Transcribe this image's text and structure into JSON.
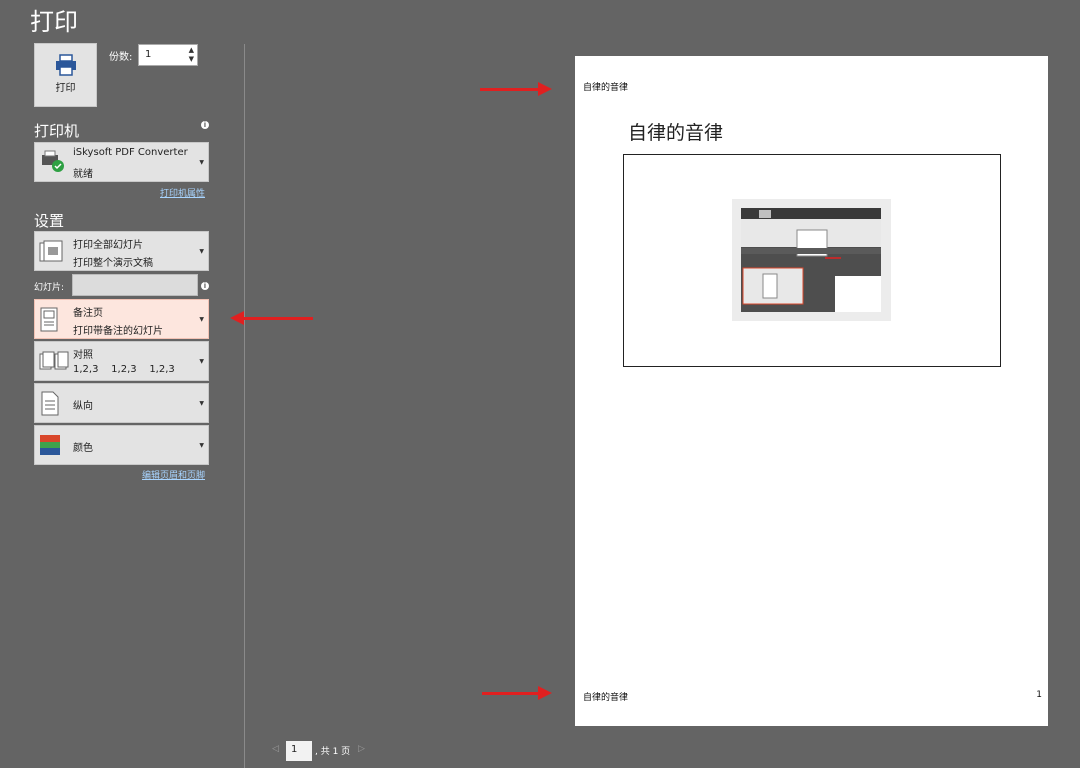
{
  "title": "打印",
  "print_button": {
    "label": "打印"
  },
  "copies": {
    "label": "份数:",
    "value": "1"
  },
  "printer": {
    "heading": "打印机",
    "name": "iSkysoft PDF Converter",
    "status": "就绪",
    "properties_link": "打印机属性"
  },
  "settings": {
    "heading": "设置",
    "range": {
      "line1": "打印全部幻灯片",
      "line2": "打印整个演示文稿"
    },
    "slides_label": "幻灯片:",
    "layout": {
      "line1": "备注页",
      "line2": "打印带备注的幻灯片"
    },
    "collate": {
      "line1": "对照",
      "line2": "1,2,3    1,2,3    1,2,3"
    },
    "orientation": {
      "line1": "纵向"
    },
    "color": {
      "line1": "颜色"
    },
    "header_footer_link": "编辑页眉和页脚"
  },
  "preview": {
    "header_text": "自律的音律",
    "slide_title": "自律的音律",
    "footer_text": "自律的音律",
    "page_number": "1"
  },
  "pager": {
    "current": "1",
    "total_text": ", 共 1 页"
  },
  "colors": {
    "background": "#646464",
    "highlight": "#fde6de",
    "arrow": "#e02020",
    "link": "#a8d4ff"
  }
}
